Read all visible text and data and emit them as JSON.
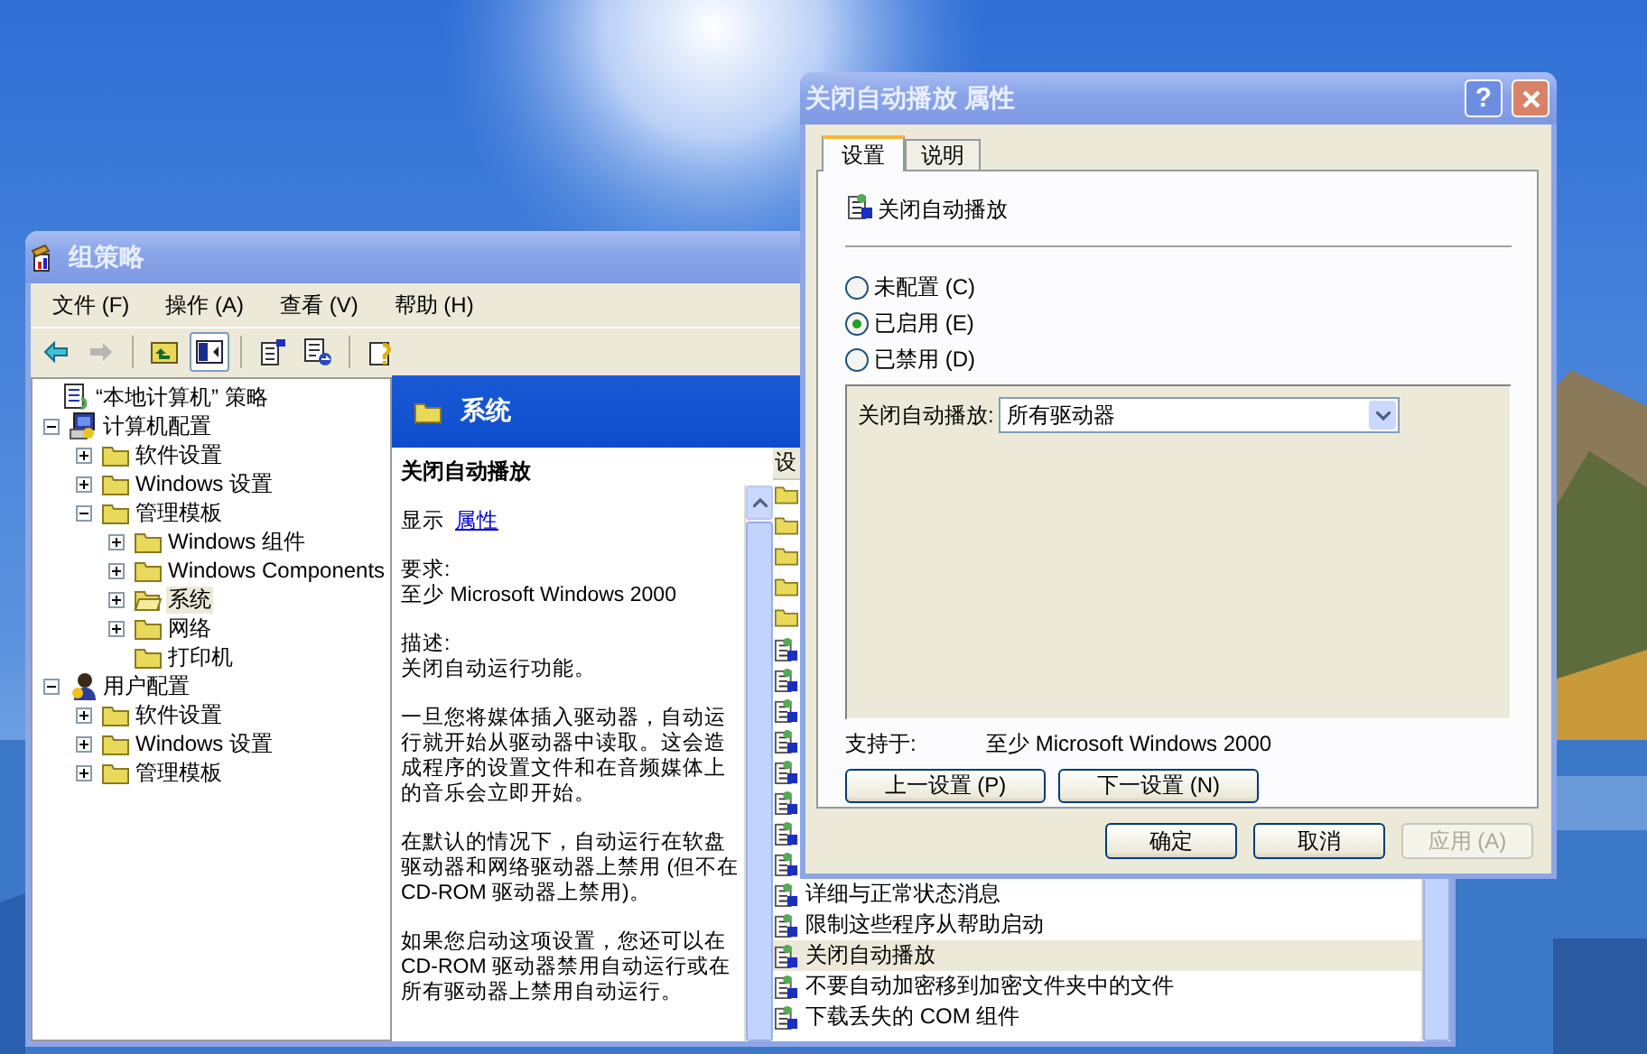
{
  "main_window": {
    "title": "组策略",
    "menu": [
      "文件 (F)",
      "操作 (A)",
      "查看 (V)",
      "帮助 (H)"
    ],
    "toolbar": [
      [
        {
          "kind": "back",
          "disabled": false,
          "pressed": false
        },
        {
          "kind": "forward",
          "disabled": true,
          "pressed": false
        }
      ],
      [
        {
          "kind": "up",
          "disabled": false,
          "pressed": false
        },
        {
          "kind": "tree",
          "disabled": false,
          "pressed": true
        }
      ],
      [
        {
          "kind": "properties",
          "disabled": false,
          "pressed": false
        },
        {
          "kind": "export",
          "disabled": false,
          "pressed": false
        }
      ],
      [
        {
          "kind": "help",
          "disabled": false,
          "pressed": false
        }
      ]
    ],
    "tree": [
      {
        "label": "“本地计算机” 策略",
        "kind": "policy",
        "selected": false,
        "children": [
          {
            "label": "计算机配置",
            "kind": "computer",
            "expanded": true,
            "selected": false,
            "children": [
              {
                "label": "软件设置",
                "kind": "folder",
                "expanded": false,
                "selected": false
              },
              {
                "label": "Windows 设置",
                "kind": "folder",
                "expanded": false,
                "selected": false
              },
              {
                "label": "管理模板",
                "kind": "folder",
                "expanded": true,
                "selected": false,
                "children": [
                  {
                    "label": "Windows 组件",
                    "kind": "folder",
                    "expanded": false,
                    "selected": false
                  },
                  {
                    "label": "Windows Components",
                    "kind": "folder",
                    "expanded": false,
                    "selected": false
                  },
                  {
                    "label": "系统",
                    "kind": "open-folder",
                    "expanded": false,
                    "selected": true
                  },
                  {
                    "label": "网络",
                    "kind": "folder",
                    "expanded": false,
                    "selected": false
                  },
                  {
                    "label": "打印机",
                    "kind": "folder",
                    "selected": false
                  }
                ]
              }
            ]
          },
          {
            "label": "用户配置",
            "kind": "user",
            "expanded": true,
            "selected": false,
            "children": [
              {
                "label": "软件设置",
                "kind": "folder",
                "expanded": false,
                "selected": false
              },
              {
                "label": "Windows 设置",
                "kind": "folder",
                "expanded": false,
                "selected": false
              },
              {
                "label": "管理模板",
                "kind": "folder",
                "expanded": false,
                "selected": false
              }
            ]
          }
        ]
      }
    ],
    "pane_title": "系统",
    "description": {
      "title": "关闭自动播放",
      "show_label": "显示",
      "show_link": "属性",
      "requirements_label": "要求:",
      "requirements": "至少 Microsoft Windows 2000",
      "description_label": "描述:",
      "paragraphs": [
        "关闭自动运行功能。",
        "一旦您将媒体插入驱动器，自动运行就开始从驱动器中读取。这会造成程序的设置文件和在音频媒体上的音乐会立即开始。",
        "在默认的情况下，自动运行在软盘驱动器和网络驱动器上禁用 (但不在 CD-ROM 驱动器上禁用)。",
        "如果您启动这项设置，您还可以在 CD-ROM 驱动器禁用自动运行或在所有驱动器上禁用自动运行。"
      ]
    },
    "list": {
      "column_1": "设",
      "rows": [
        {
          "kind": "folder",
          "selected": false
        },
        {
          "kind": "folder",
          "selected": false
        },
        {
          "kind": "folder",
          "selected": false
        },
        {
          "kind": "folder",
          "selected": false
        },
        {
          "kind": "folder",
          "selected": false
        },
        {
          "kind": "policy",
          "selected": false
        },
        {
          "kind": "policy",
          "selected": false
        },
        {
          "kind": "policy",
          "selected": false
        },
        {
          "kind": "policy",
          "selected": false
        },
        {
          "kind": "policy",
          "selected": false
        },
        {
          "kind": "policy",
          "selected": false
        },
        {
          "kind": "policy",
          "selected": false
        },
        {
          "kind": "policy",
          "selected": false
        },
        {
          "kind": "policy",
          "label": "详细与正常状态消息",
          "selected": false
        },
        {
          "kind": "policy",
          "label": "限制这些程序从帮助启动",
          "selected": false
        },
        {
          "kind": "policy",
          "label": "关闭自动播放",
          "selected": true
        },
        {
          "kind": "policy",
          "label": "不要自动加密移到加密文件夹中的文件",
          "selected": false
        },
        {
          "kind": "policy",
          "label": "下载丢失的 COM 组件",
          "selected": false
        }
      ]
    }
  },
  "dialog": {
    "title": "关闭自动播放 属性",
    "help_button": "?",
    "tabs": [
      {
        "label": "设置",
        "selected": true
      },
      {
        "label": "说明",
        "selected": false
      }
    ],
    "setting_name": "关闭自动播放",
    "options": [
      {
        "label": "未配置 (C)",
        "selected": false
      },
      {
        "label": "已启用 (E)",
        "selected": true
      },
      {
        "label": "已禁用 (D)",
        "selected": false
      }
    ],
    "option_label": "关闭自动播放:",
    "option_value": "所有驱动器",
    "supported_label": "支持于:",
    "supported_value": "至少 Microsoft Windows 2000",
    "nav_buttons": [
      {
        "label": "上一设置 (P)",
        "disabled": false
      },
      {
        "label": "下一设置 (N)",
        "disabled": false
      }
    ],
    "buttons": [
      {
        "label": "确定",
        "disabled": false
      },
      {
        "label": "取消",
        "disabled": false
      },
      {
        "label": "应用 (A)",
        "disabled": true
      }
    ]
  }
}
